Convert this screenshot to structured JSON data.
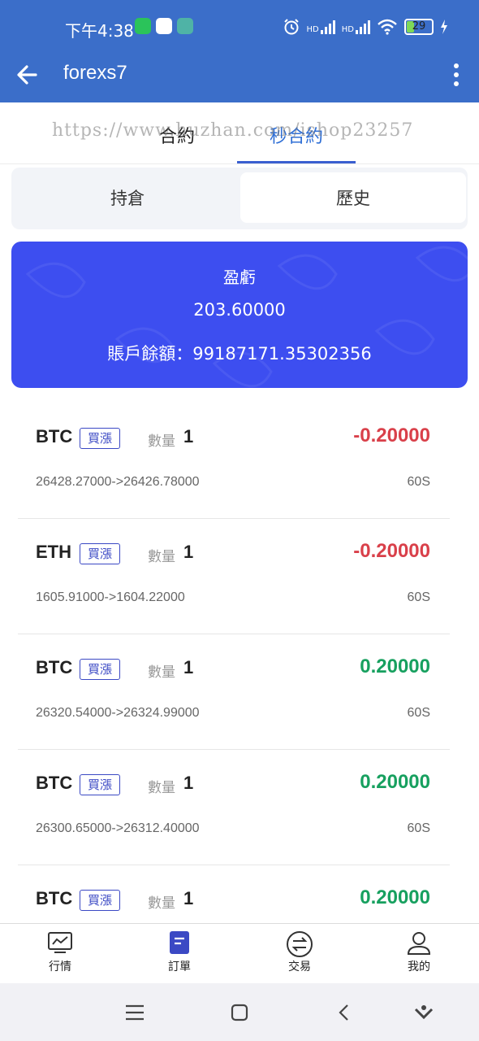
{
  "status": {
    "time": "下午4:38",
    "signal1": "HD",
    "signal2": "HD",
    "battery": "29",
    "battery_level": 0.29
  },
  "appbar": {
    "title": "forexs7"
  },
  "toptabs": [
    {
      "label": "合約",
      "active": false
    },
    {
      "label": "秒合約",
      "active": true
    }
  ],
  "watermark": "https://www.huzhan.com/ishop23257",
  "segments": [
    {
      "label": "持倉",
      "active": false
    },
    {
      "label": "歷史",
      "active": true
    }
  ],
  "summary": {
    "label": "盈虧",
    "value": "203.60000",
    "balance": "賬戶餘額：99187171.35302356"
  },
  "orders": [
    {
      "symbol": "BTC",
      "direction": "買漲",
      "qty_label": "數量",
      "qty": "1",
      "pnl": "-0.20000",
      "pnl_sign": "neg",
      "prices": "26428.27000->26426.78000",
      "duration": "60S"
    },
    {
      "symbol": "ETH",
      "direction": "買漲",
      "qty_label": "數量",
      "qty": "1",
      "pnl": "-0.20000",
      "pnl_sign": "neg",
      "prices": "1605.91000->1604.22000",
      "duration": "60S"
    },
    {
      "symbol": "BTC",
      "direction": "買漲",
      "qty_label": "數量",
      "qty": "1",
      "pnl": "0.20000",
      "pnl_sign": "pos",
      "prices": "26320.54000->26324.99000",
      "duration": "60S"
    },
    {
      "symbol": "BTC",
      "direction": "買漲",
      "qty_label": "數量",
      "qty": "1",
      "pnl": "0.20000",
      "pnl_sign": "pos",
      "prices": "26300.65000->26312.40000",
      "duration": "60S"
    },
    {
      "symbol": "BTC",
      "direction": "買漲",
      "qty_label": "數量",
      "qty": "1",
      "pnl": "0.20000",
      "pnl_sign": "pos",
      "prices": "",
      "duration": ""
    }
  ],
  "bottom_nav": [
    {
      "label": "行情",
      "icon": "chart-icon",
      "active": false
    },
    {
      "label": "訂單",
      "icon": "order-icon",
      "active": true
    },
    {
      "label": "交易",
      "icon": "exchange-icon",
      "active": false
    },
    {
      "label": "我的",
      "icon": "user-icon",
      "active": false
    }
  ],
  "colors": {
    "appbar": "#3b6ec9",
    "card": "#3d4ef0",
    "negative": "#d9404a",
    "positive": "#17a05f",
    "accent": "#3a5fd0"
  }
}
